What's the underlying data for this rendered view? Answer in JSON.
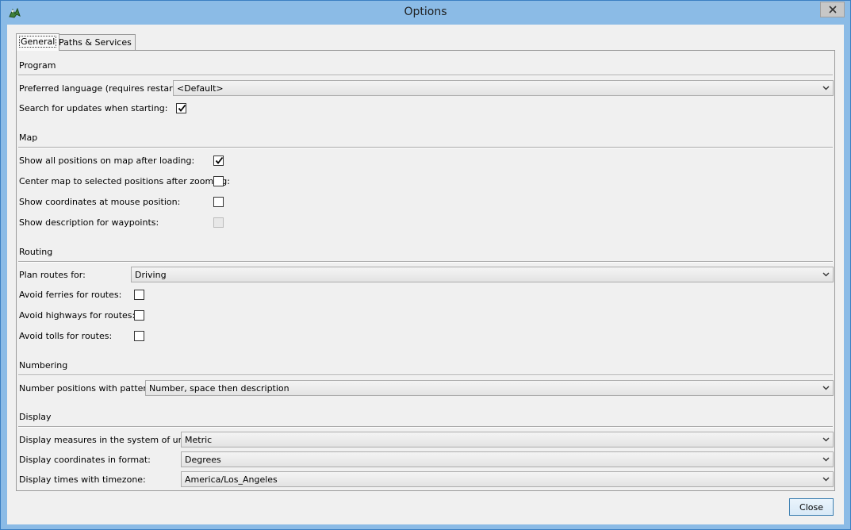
{
  "window": {
    "title": "Options"
  },
  "tabs": [
    {
      "label": "General",
      "active": true
    },
    {
      "label": "Paths & Services",
      "active": false
    }
  ],
  "program": {
    "title": "Program",
    "language_label": "Preferred language (requires restart):",
    "language_value": "<Default>",
    "updates_label": "Search for updates when starting:",
    "updates_checked": true
  },
  "map": {
    "title": "Map",
    "show_all_label": "Show all positions on map after loading:",
    "show_all_checked": true,
    "center_label": "Center map to selected positions after zooming:",
    "center_checked": false,
    "coords_label": "Show coordinates at mouse position:",
    "coords_checked": false,
    "desc_label": "Show description for waypoints:",
    "desc_checked": false,
    "desc_enabled": false
  },
  "routing": {
    "title": "Routing",
    "plan_label": "Plan routes for:",
    "plan_value": "Driving",
    "ferries_label": "Avoid ferries for routes:",
    "ferries_checked": false,
    "highways_label": "Avoid highways for routes:",
    "highways_checked": false,
    "tolls_label": "Avoid tolls for routes:",
    "tolls_checked": false
  },
  "numbering": {
    "title": "Numbering",
    "pattern_label": "Number positions with pattern:",
    "pattern_value": "Number, space then description"
  },
  "display": {
    "title": "Display",
    "units_label": "Display measures in the system of units:",
    "units_value": "Metric",
    "format_label": "Display coordinates in format:",
    "format_value": "Degrees",
    "timezone_label": "Display times with timezone:",
    "timezone_value": "America/Los_Angeles"
  },
  "footer": {
    "close_label": "Close"
  },
  "colors": {
    "titlebar": "#8bbbe6",
    "panel": "#f0f0f0",
    "accent": "#3c7fb1"
  }
}
